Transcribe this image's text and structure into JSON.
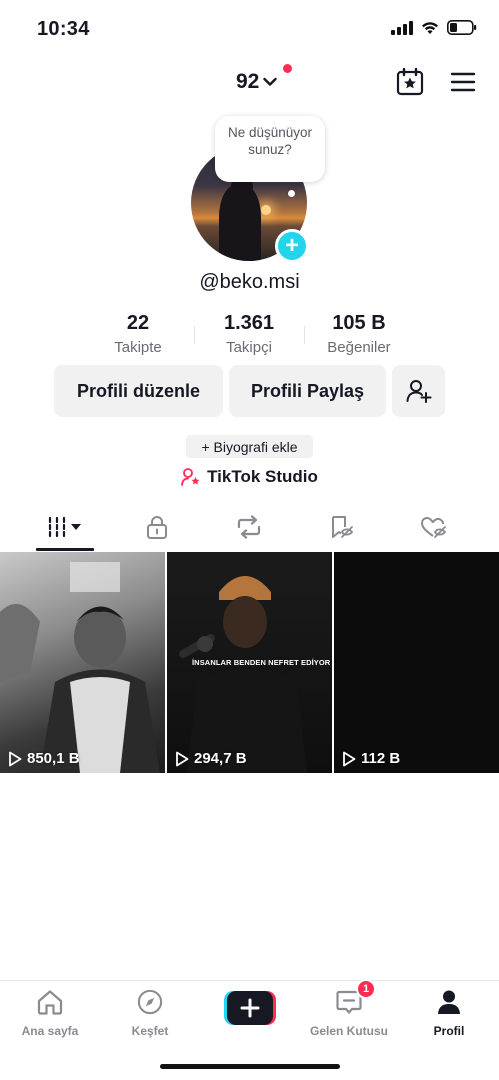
{
  "status_bar": {
    "time": "10:34"
  },
  "header": {
    "account_name": "92"
  },
  "profile": {
    "thought_bubble": "Ne düşünüyorsunuz?",
    "username": "@beko.msi"
  },
  "stats": [
    {
      "value": "22",
      "label": "Takipte"
    },
    {
      "value": "1.361",
      "label": "Takipçi"
    },
    {
      "value": "105 B",
      "label": "Beğeniler"
    }
  ],
  "actions": {
    "edit_profile": "Profili düzenle",
    "share_profile": "Profili Paylaş",
    "add_bio": "+ Biyografi ekle",
    "studio": "TikTok Studio"
  },
  "videos": [
    {
      "views": "850,1 B"
    },
    {
      "views": "294,7 B",
      "caption": "İNSANLAR BENDEN NEFRET EDİYOR"
    },
    {
      "views": "112 B"
    }
  ],
  "bottom_nav": {
    "home": "Ana sayfa",
    "discover": "Keşfet",
    "inbox": "Gelen Kutusu",
    "inbox_badge": "1",
    "profile": "Profil"
  },
  "colors": {
    "accent": "#fe2c55",
    "cyan": "#20d5ec",
    "text": "#161823",
    "muted": "#6b6c72"
  }
}
